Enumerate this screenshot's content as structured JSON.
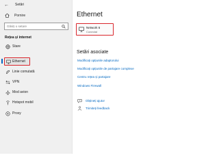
{
  "window": {
    "app_title": "Setări",
    "back_icon": "back-arrow-icon",
    "controls": {
      "minimize_icon": "minimize-icon",
      "maximize_icon": "maximize-icon",
      "close_icon": "close-icon"
    }
  },
  "sidebar": {
    "home": {
      "label": "Pornire",
      "icon": "home-icon"
    },
    "search": {
      "placeholder": "Găsiți o setare",
      "value": "",
      "icon": "search-icon"
    },
    "section_title": "Rețea și internet",
    "items": [
      {
        "label": "Stare",
        "icon": "status-icon",
        "selected": false
      },
      {
        "label": "Ethernet",
        "icon": "ethernet-icon",
        "selected": true
      },
      {
        "label": "Linie comutată",
        "icon": "dial-up-icon",
        "selected": false
      },
      {
        "label": "VPN",
        "icon": "vpn-icon",
        "selected": false
      },
      {
        "label": "Mod avion",
        "icon": "airplane-icon",
        "selected": false
      },
      {
        "label": "Hotspot mobil",
        "icon": "hotspot-icon",
        "selected": false
      },
      {
        "label": "Proxy",
        "icon": "proxy-icon",
        "selected": false
      }
    ]
  },
  "main": {
    "title": "Ethernet",
    "network": {
      "name": "Network 6",
      "status": "Conectat",
      "icon": "ethernet-monitor-icon"
    },
    "related_heading": "Setări asociate",
    "related_links": [
      "Modificați opțiunile adaptorului",
      "Modificați opțiunile de partajare complexe",
      "Centru rețea și partajare",
      "Windows Firewall"
    ],
    "help_links": [
      {
        "label": "Obțineți ajutor",
        "icon": "help-icon"
      },
      {
        "label": "Trimiteți feedback",
        "icon": "feedback-icon"
      }
    ]
  },
  "colors": {
    "accent": "#0067c0",
    "highlight_border": "#d9252b",
    "sidebar_bg": "#f0f0f0"
  }
}
